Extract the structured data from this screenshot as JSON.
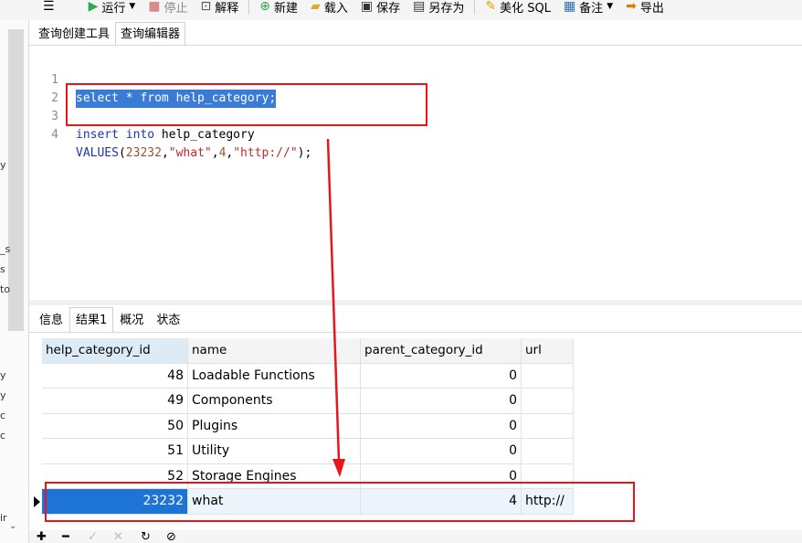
{
  "toolbar": {
    "run": "运行",
    "stop": "停止",
    "explain": "解释",
    "new": "新建",
    "load": "载入",
    "save": "保存",
    "save_as": "另存为",
    "beautify": "美化 SQL",
    "note": "备注",
    "export": "导出"
  },
  "top_tabs": [
    "查询创建工具",
    "查询编辑器"
  ],
  "editor": {
    "lines": [
      {
        "n": "1",
        "text": "select * from help_category;"
      },
      {
        "n": "2",
        "text": ""
      },
      {
        "n": "3",
        "kw": "insert into",
        "rest": " help_category"
      },
      {
        "n": "4",
        "kw": "VALUES",
        "p1": "(",
        "v1": "23232",
        "c1": ",",
        "v2": "\"what\"",
        "c2": ",",
        "v3": "4",
        "c3": ",",
        "v4": "\"http://\"",
        "end": ");"
      }
    ]
  },
  "bottom_tabs": [
    "信息",
    "结果1",
    "概况",
    "状态"
  ],
  "grid": {
    "headers": [
      "help_category_id",
      "name",
      "parent_category_id",
      "url"
    ],
    "rows": [
      [
        "48",
        "Loadable Functions",
        "0",
        ""
      ],
      [
        "49",
        "Components",
        "0",
        ""
      ],
      [
        "50",
        "Plugins",
        "0",
        ""
      ],
      [
        "51",
        "Utility",
        "0",
        ""
      ],
      [
        "52",
        "Storage Engines",
        "0",
        ""
      ],
      [
        "23232",
        "what",
        "4",
        "http://"
      ]
    ]
  },
  "left_panel": {
    "fragments": [
      "y",
      "_s",
      "s",
      "to",
      "y",
      "y",
      "c",
      "c",
      "ir"
    ]
  },
  "colors": {
    "accent": "#1e73d6",
    "annotation": "#e8161b"
  }
}
